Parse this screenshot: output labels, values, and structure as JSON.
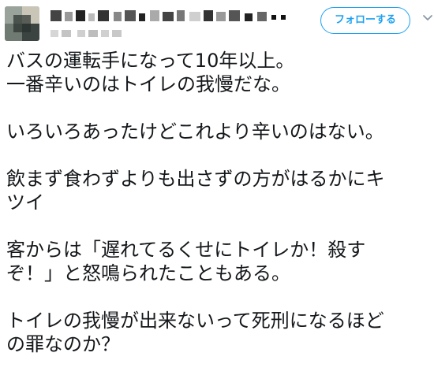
{
  "follow_button": {
    "label": "フォローする"
  },
  "tweet": {
    "paragraphs": [
      [
        "バスの運転手になって10年以上。",
        "一番辛いのはトイレの我慢だな。"
      ],
      [
        "いろいろあったけどこれより辛いのはない。"
      ],
      [
        "飲まず食わずよりも出さずの方がはるかにキ",
        "ツイ"
      ],
      [
        "客からは「遅れてるくせにトイレか！殺す",
        "ぞ！」と怒鳴られたこともある。"
      ],
      [
        "トイレの我慢が出来ないって死刑になるほど",
        "の罪なのか？"
      ]
    ]
  },
  "colors": {
    "accent": "#1da1f2",
    "text": "#14171a"
  },
  "icons": {
    "menu": "chevron-down-icon"
  }
}
